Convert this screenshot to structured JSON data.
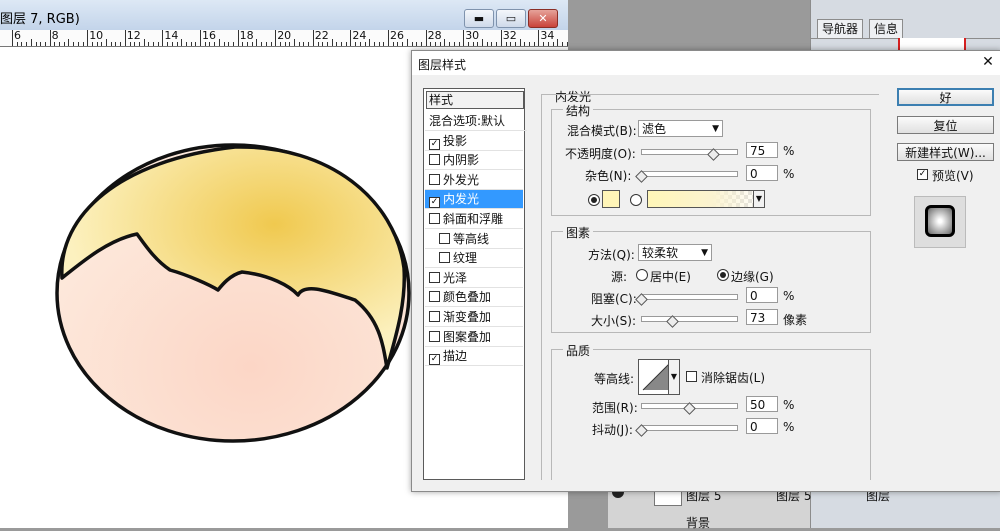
{
  "document": {
    "title": "图层 7, RGB)",
    "window_buttons": {
      "minimize": "▬",
      "restore": "▭",
      "close": "✕"
    },
    "ruler_labels": [
      "6",
      "8",
      "10",
      "12",
      "14",
      "16",
      "18",
      "20",
      "22",
      "24",
      "26",
      "28",
      "30",
      "32",
      "34"
    ]
  },
  "navigator": {
    "tabs": [
      "导航器",
      "信息"
    ]
  },
  "layers": {
    "rows": [
      "图层 5",
      "图层 5",
      "图层",
      "背景"
    ]
  },
  "dialog": {
    "title": "图层样式",
    "close_glyph": "✕",
    "styles_header": "样式",
    "styles": [
      {
        "label": "混合选项:默认",
        "checkbox": false,
        "checked": false,
        "selected": false,
        "indent": false
      },
      {
        "label": "投影",
        "checkbox": true,
        "checked": true,
        "selected": false,
        "indent": false
      },
      {
        "label": "内阴影",
        "checkbox": true,
        "checked": false,
        "selected": false,
        "indent": false
      },
      {
        "label": "外发光",
        "checkbox": true,
        "checked": false,
        "selected": false,
        "indent": false
      },
      {
        "label": "内发光",
        "checkbox": true,
        "checked": true,
        "selected": true,
        "indent": false
      },
      {
        "label": "斜面和浮雕",
        "checkbox": true,
        "checked": false,
        "selected": false,
        "indent": false
      },
      {
        "label": "等高线",
        "checkbox": true,
        "checked": false,
        "selected": false,
        "indent": true
      },
      {
        "label": "纹理",
        "checkbox": true,
        "checked": false,
        "selected": false,
        "indent": true
      },
      {
        "label": "光泽",
        "checkbox": true,
        "checked": false,
        "selected": false,
        "indent": false
      },
      {
        "label": "颜色叠加",
        "checkbox": true,
        "checked": false,
        "selected": false,
        "indent": false
      },
      {
        "label": "渐变叠加",
        "checkbox": true,
        "checked": false,
        "selected": false,
        "indent": false
      },
      {
        "label": "图案叠加",
        "checkbox": true,
        "checked": false,
        "selected": false,
        "indent": false
      },
      {
        "label": "描边",
        "checkbox": true,
        "checked": true,
        "selected": false,
        "indent": false
      }
    ],
    "section_title": "内发光",
    "structure": {
      "title": "结构",
      "blend_mode_label": "混合模式(B):",
      "blend_mode_value": "滤色",
      "opacity_label": "不透明度(O):",
      "opacity_value": "75",
      "opacity_unit": "%",
      "noise_label": "杂色(N):",
      "noise_value": "0",
      "noise_unit": "%",
      "color_value": "#fff5b8"
    },
    "elements": {
      "title": "图素",
      "technique_label": "方法(Q):",
      "technique_value": "较柔软",
      "source_label": "源:",
      "source_center": "居中(E)",
      "source_edge": "边缘(G)",
      "choke_label": "阻塞(C):",
      "choke_value": "0",
      "choke_unit": "%",
      "size_label": "大小(S):",
      "size_value": "73",
      "size_unit": "像素"
    },
    "quality": {
      "title": "品质",
      "contour_label": "等高线:",
      "antialias_label": "消除锯齿(L)",
      "range_label": "范围(R):",
      "range_value": "50",
      "range_unit": "%",
      "jitter_label": "抖动(J):",
      "jitter_value": "0",
      "jitter_unit": "%"
    },
    "buttons": {
      "ok": "好",
      "reset": "复位",
      "new_style": "新建样式(W)...",
      "preview": "预览(V)"
    }
  },
  "colors": {
    "hair_top": "#f0c94f",
    "hair_light": "#fbf0b8",
    "skin": "#fde4d4",
    "selection": "#3399ff"
  }
}
